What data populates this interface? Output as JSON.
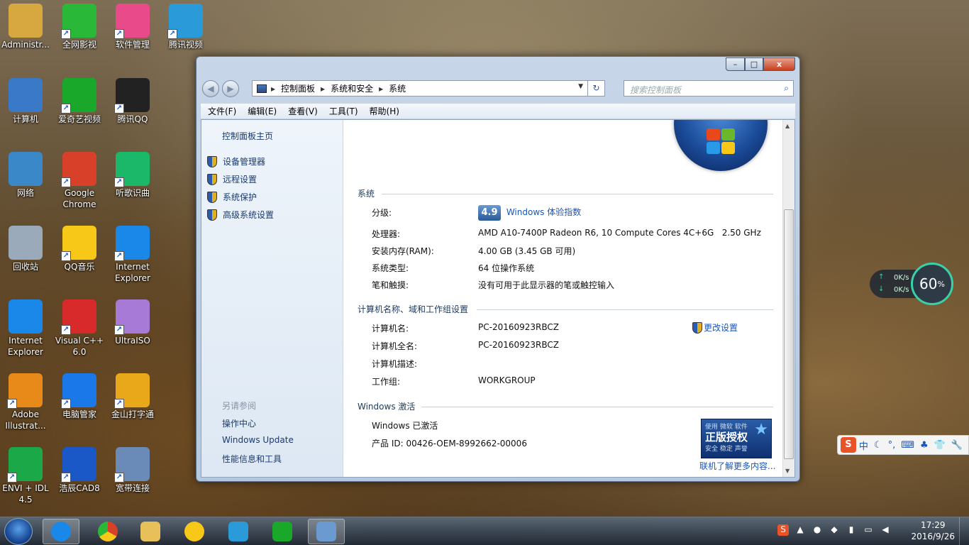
{
  "desktop": {
    "icons": [
      {
        "label": "Administr...",
        "glyph": "folder",
        "color": "#d8a840"
      },
      {
        "label": "全网影视",
        "glyph": "全网影视",
        "color": "#2ab838"
      },
      {
        "label": "软件管理",
        "glyph": "apps",
        "color": "#e84a8a"
      },
      {
        "label": "腾讯视频",
        "glyph": "play",
        "color": "#2a9ad8"
      },
      {
        "label": "计算机",
        "glyph": "computer",
        "color": "#3a78c8"
      },
      {
        "label": "爱奇艺视频",
        "glyph": "iQIYI",
        "color": "#1aa82a"
      },
      {
        "label": "腾讯QQ",
        "glyph": "penguin",
        "color": "#222"
      },
      {
        "label": "网络",
        "glyph": "network",
        "color": "#3a88c8"
      },
      {
        "label": "Google Chrome",
        "glyph": "chrome",
        "color": "#d8402a"
      },
      {
        "label": "听歌识曲",
        "glyph": "music",
        "color": "#1ab868"
      },
      {
        "label": "回收站",
        "glyph": "bin",
        "color": "#9aaabb"
      },
      {
        "label": "QQ音乐",
        "glyph": "qqmusic",
        "color": "#f8c818"
      },
      {
        "label": "Internet Explorer",
        "glyph": "ie",
        "color": "#1a88e8"
      },
      {
        "label": "Internet Explorer",
        "glyph": "ie",
        "color": "#1a88e8"
      },
      {
        "label": "Visual C++ 6.0",
        "glyph": "vc",
        "color": "#d82a2a"
      },
      {
        "label": "UltraISO",
        "glyph": "disc",
        "color": "#a87ad8"
      },
      {
        "label": "Adobe Illustrat...",
        "glyph": "Ai",
        "color": "#e88a1a"
      },
      {
        "label": "电脑管家",
        "glyph": "shield",
        "color": "#1a78e8"
      },
      {
        "label": "金山打字通",
        "glyph": "typing",
        "color": "#e8a81a"
      },
      {
        "label": "ENVI + IDL 4.5",
        "glyph": "globe",
        "color": "#1aa848"
      },
      {
        "label": "浩辰CAD8",
        "glyph": "G",
        "color": "#1a58c8"
      },
      {
        "label": "宽带连接",
        "glyph": "net",
        "color": "#6a8ab8"
      }
    ]
  },
  "window": {
    "controls": {
      "minimize": "–",
      "maximize": "□",
      "close": "x"
    },
    "nav": {
      "back": "◀",
      "forward": "▶",
      "refresh": "↻"
    },
    "breadcrumb": [
      "控制面板",
      "系统和安全",
      "系统"
    ],
    "search_placeholder": "搜索控制面板",
    "menu": [
      "文件(F)",
      "编辑(E)",
      "查看(V)",
      "工具(T)",
      "帮助(H)"
    ],
    "left_pane": {
      "home": "控制面板主页",
      "tasks": [
        "设备管理器",
        "远程设置",
        "系统保护",
        "高级系统设置"
      ],
      "see_also_title": "另请参阅",
      "see_also": [
        "操作中心",
        "Windows Update",
        "性能信息和工具"
      ]
    },
    "system": {
      "section_title": "系统",
      "rating_label": "分级:",
      "rating_score": "4.9",
      "rating_link": "Windows 体验指数",
      "processor_label": "处理器:",
      "processor_value": "AMD A10-7400P Radeon R6, 10 Compute Cores 4C+6G   2.50 GHz",
      "ram_label": "安装内存(RAM):",
      "ram_value": "4.00 GB (3.45 GB 可用)",
      "type_label": "系统类型:",
      "type_value": "64 位操作系统",
      "pen_label": "笔和触摸:",
      "pen_value": "没有可用于此显示器的笔或触控输入"
    },
    "computer": {
      "section_title": "计算机名称、域和工作组设置",
      "name_label": "计算机名:",
      "name_value": "PC-20160923RBCZ",
      "fullname_label": "计算机全名:",
      "fullname_value": "PC-20160923RBCZ",
      "desc_label": "计算机描述:",
      "desc_value": "",
      "workgroup_label": "工作组:",
      "workgroup_value": "WORKGROUP",
      "change_link": "更改设置"
    },
    "activation": {
      "section_title": "Windows 激活",
      "status": "Windows 已激活",
      "product_id": "产品 ID: 00426-OEM-8992662-00006",
      "genuine_top": "使用 微软 软件",
      "genuine_main": "正版授权",
      "genuine_sub": "安全 稳定 声誉",
      "more_link": "联机了解更多内容..."
    }
  },
  "net_widget": {
    "up": "0K/s",
    "down": "0K/s",
    "percent": "60",
    "percent_unit": "%"
  },
  "sogou": {
    "logo": "S",
    "mode": "中",
    "items": [
      "☾",
      "°,",
      "⌨",
      "♣",
      "👕",
      "🔧"
    ]
  },
  "taskbar": {
    "clock_time": "17:29",
    "clock_date": "2016/9/26"
  }
}
